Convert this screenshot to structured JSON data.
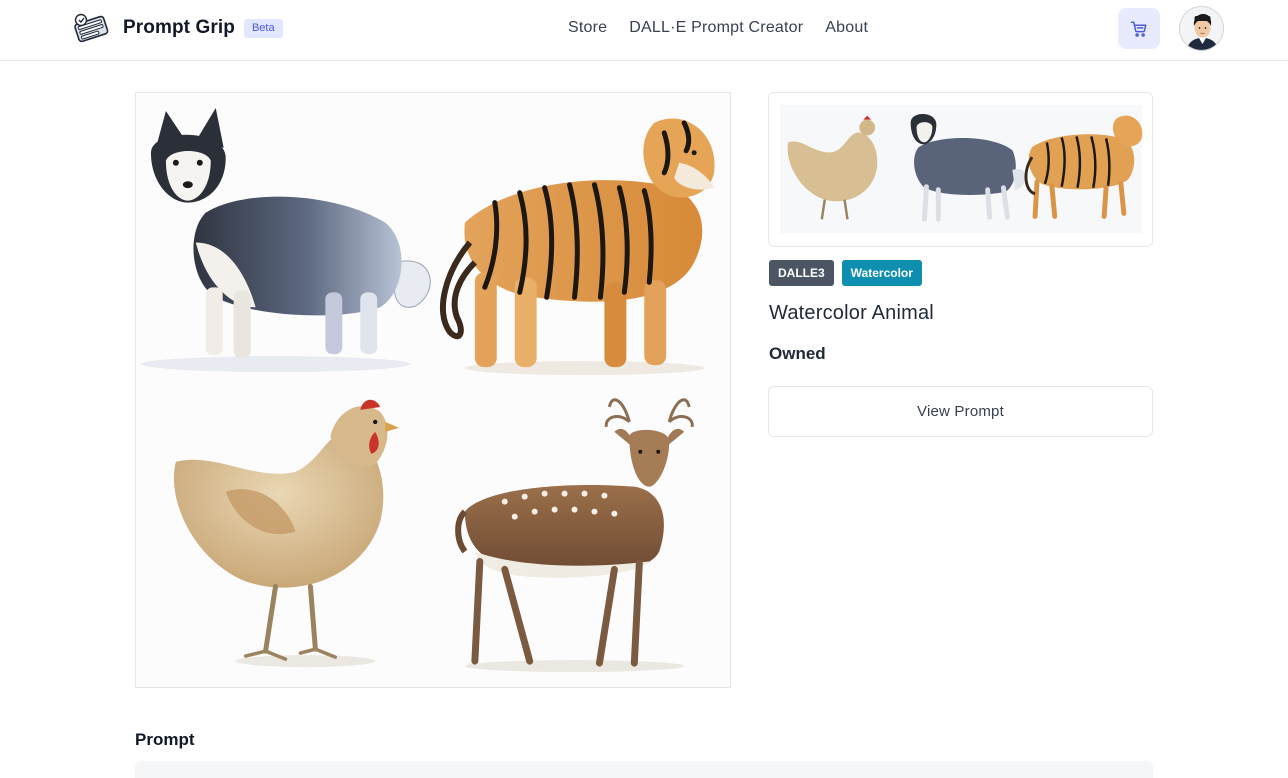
{
  "header": {
    "brand_name": "Prompt Grip",
    "beta_label": "Beta",
    "nav": [
      {
        "label": "Store"
      },
      {
        "label": "DALL·E Prompt Creator"
      },
      {
        "label": "About"
      }
    ],
    "cart_icon": "cart-icon",
    "avatar_icon": "user-avatar"
  },
  "product": {
    "tags": [
      {
        "label": "DALLE3",
        "color": "#4b5563"
      },
      {
        "label": "Watercolor",
        "color": "#0e8fb0"
      }
    ],
    "title": "Watercolor Animal",
    "ownership": "Owned",
    "view_prompt_label": "View Prompt",
    "main_image_subjects": [
      "husky",
      "tiger",
      "chicken",
      "deer"
    ],
    "thumbnail_subjects": [
      "chicken",
      "husky",
      "tiger"
    ]
  },
  "prompt_section": {
    "heading": "Prompt"
  },
  "colors": {
    "accent": "#4f5bd5",
    "accent_bg": "#e0e7ff",
    "tag_model": "#4b5563",
    "tag_style": "#0e8fb0"
  }
}
